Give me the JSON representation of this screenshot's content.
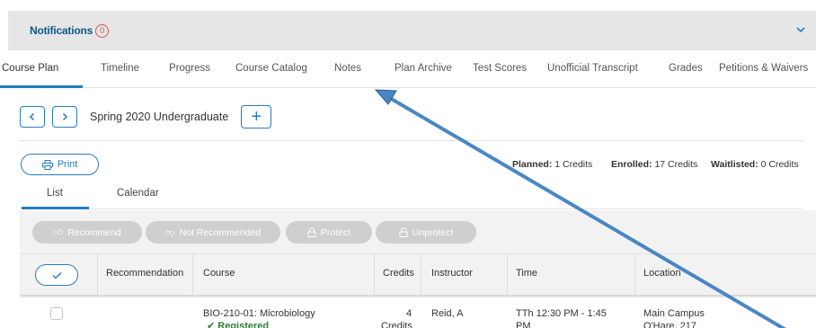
{
  "notifications": {
    "title": "Notifications",
    "count": "0"
  },
  "tabs": [
    {
      "label": "Course Plan"
    },
    {
      "label": "Timeline"
    },
    {
      "label": "Progress"
    },
    {
      "label": "Course Catalog"
    },
    {
      "label": "Notes"
    },
    {
      "label": "Plan Archive"
    },
    {
      "label": "Test Scores"
    },
    {
      "label": "Unofficial Transcript"
    },
    {
      "label": "Grades"
    },
    {
      "label": "Petitions & Waivers"
    }
  ],
  "term": {
    "label": "Spring 2020 Undergraduate",
    "add_label": "+"
  },
  "print_label": "Print",
  "credits": {
    "planned_label": "Planned:",
    "planned_value": "1 Credits",
    "enrolled_label": "Enrolled:",
    "enrolled_value": "17 Credits",
    "waitlisted_label": "Waitlisted:",
    "waitlisted_value": "0 Credits"
  },
  "subtabs": [
    {
      "label": "List"
    },
    {
      "label": "Calendar"
    }
  ],
  "actions": {
    "recommend": "Recommend",
    "not_recommended": "Not Recommended",
    "protect": "Protect",
    "unprotect": "Unprotect"
  },
  "columns": {
    "recommendation": "Recommendation",
    "course": "Course",
    "credits": "Credits",
    "instructor": "Instructor",
    "time": "Time",
    "location": "Location"
  },
  "rows": [
    {
      "course": "BIO-210-01: Microbiology",
      "status": "✔ Registered",
      "credits_num": "4",
      "credits_unit": "Credits",
      "instructor": "Reid, A",
      "time_line1": "TTh 12:30 PM - 1:45",
      "time_line2": "PM",
      "location_line1": "Main Campus",
      "location_line2": "O'Hare, 217"
    }
  ],
  "colors": {
    "accent": "#1f7ec0",
    "arrow": "#4a86c5",
    "badge": "#d9534f",
    "success": "#2e7d32"
  }
}
